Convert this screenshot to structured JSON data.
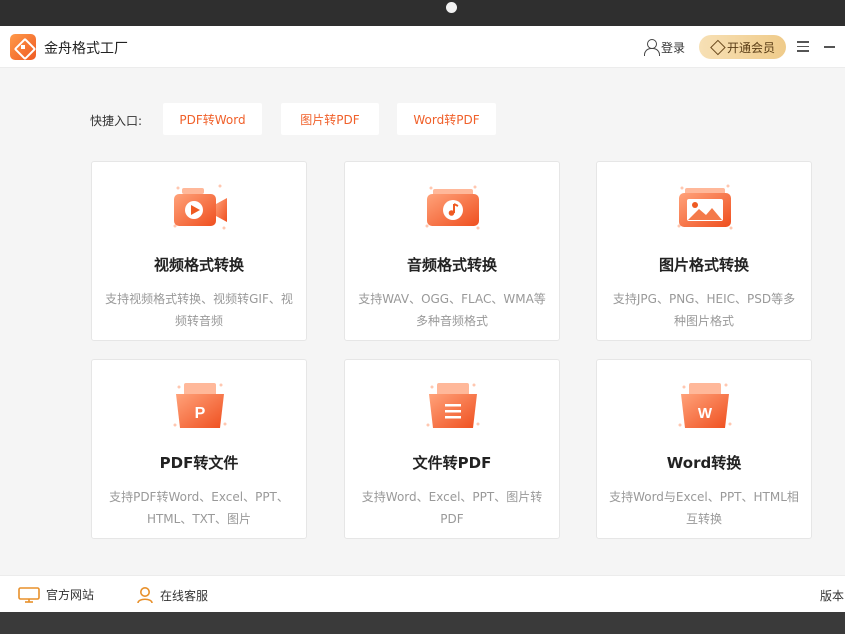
{
  "window": {
    "title": "金舟格式工厂"
  },
  "header": {
    "login_label": "登录",
    "vip_label": "开通会员"
  },
  "quick_entry": {
    "label": "快捷入口:",
    "buttons": [
      "PDF转Word",
      "图片转PDF",
      "Word转PDF"
    ]
  },
  "cards": [
    {
      "title": "视频格式转换",
      "desc": "支持视频格式转换、视频转GIF、视频转音频",
      "icon": "video-convert-icon"
    },
    {
      "title": "音频格式转换",
      "desc": "支持WAV、OGG、FLAC、WMA等多种音频格式",
      "icon": "audio-convert-icon"
    },
    {
      "title": "图片格式转换",
      "desc": "支持JPG、PNG、HEIC、PSD等多种图片格式",
      "icon": "image-convert-icon"
    },
    {
      "title": "PDF转文件",
      "desc": "支持PDF转Word、Excel、PPT、HTML、TXT、图片",
      "icon": "pdf-file-icon"
    },
    {
      "title": "文件转PDF",
      "desc": "支持Word、Excel、PPT、图片转PDF",
      "icon": "file-to-pdf-icon"
    },
    {
      "title": "Word转换",
      "desc": "支持Word与Excel、PPT、HTML相互转换",
      "icon": "word-file-icon"
    }
  ],
  "footer": {
    "website_label": "官方网站",
    "support_label": "在线客服",
    "version_label": "版本"
  },
  "colors": {
    "accent": "#f0602a",
    "icon_gradient_start": "#ff9a6a",
    "icon_gradient_end": "#ef4f1f",
    "vip_gold": "#efcb8a"
  }
}
